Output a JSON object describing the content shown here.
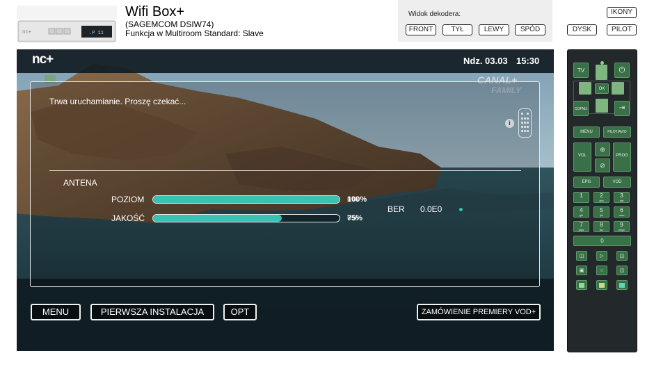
{
  "header": {
    "title": "Wifi Box+",
    "model": "(SAGEMCOM DSIW74)",
    "multiroom": "Funkcja w Multiroom Standard: Slave"
  },
  "device_thumb": {
    "front_logo": "nc+",
    "display_text": ".P  11"
  },
  "view_panel": {
    "label": "Widok dekodera:",
    "buttons": [
      "FRONT",
      "TYŁ",
      "LEWY",
      "SPÓD"
    ]
  },
  "right_buttons": {
    "icons": "IKONY",
    "disk": "DYSK",
    "remote": "PILOT"
  },
  "tv": {
    "logo": "nc+",
    "date": "Ndz. 03.03",
    "time": "15:30",
    "channel_logo": "CANAL+",
    "channel_logo_sub": "FAMILY",
    "status_message": "Trwa uruchamianie. Proszę czekać...",
    "section_title": "ANTENA",
    "meters": [
      {
        "label": "POZIOM",
        "percent_text": "100%",
        "percent_overlay": "0%",
        "fill_fraction": 1.0
      },
      {
        "label": "JAKOŚĆ",
        "percent_text": "75%",
        "percent_overlay": "0%",
        "fill_fraction": 0.69
      }
    ],
    "ber_label": "BER",
    "ber_value": "0.0E0",
    "buttons": {
      "menu": "MENU",
      "first_install": "PIERWSZA INSTALACJA",
      "opt": "OPT",
      "vod": "ZAMÓWIENIE PREMIERY VOD+"
    }
  },
  "remote": {
    "tv": "TV",
    "ok": "OK",
    "back": "COFNIJ",
    "menu": "MENU",
    "pilot_av": "PILOT/AV/O",
    "vol": "VOL",
    "prog": "PROG",
    "epg": "EPG",
    "vod": "VOD",
    "numbers": [
      {
        "digit": "1",
        "letters": ""
      },
      {
        "digit": "2",
        "letters": "abc"
      },
      {
        "digit": "3",
        "letters": "def"
      },
      {
        "digit": "4",
        "letters": "ghi"
      },
      {
        "digit": "5",
        "letters": "jkl"
      },
      {
        "digit": "6",
        "letters": "mno"
      },
      {
        "digit": "7",
        "letters": "pqrs"
      },
      {
        "digit": "8",
        "letters": "tuv"
      },
      {
        "digit": "9",
        "letters": "wxyz"
      }
    ],
    "zero": "0",
    "colors": {
      "body": "#23292b",
      "button": "#3a7048",
      "accent": "#7fb67f"
    }
  },
  "colors": {
    "meter_fill": "#38c2b4",
    "view_panel_bg": "#eeeeee"
  }
}
